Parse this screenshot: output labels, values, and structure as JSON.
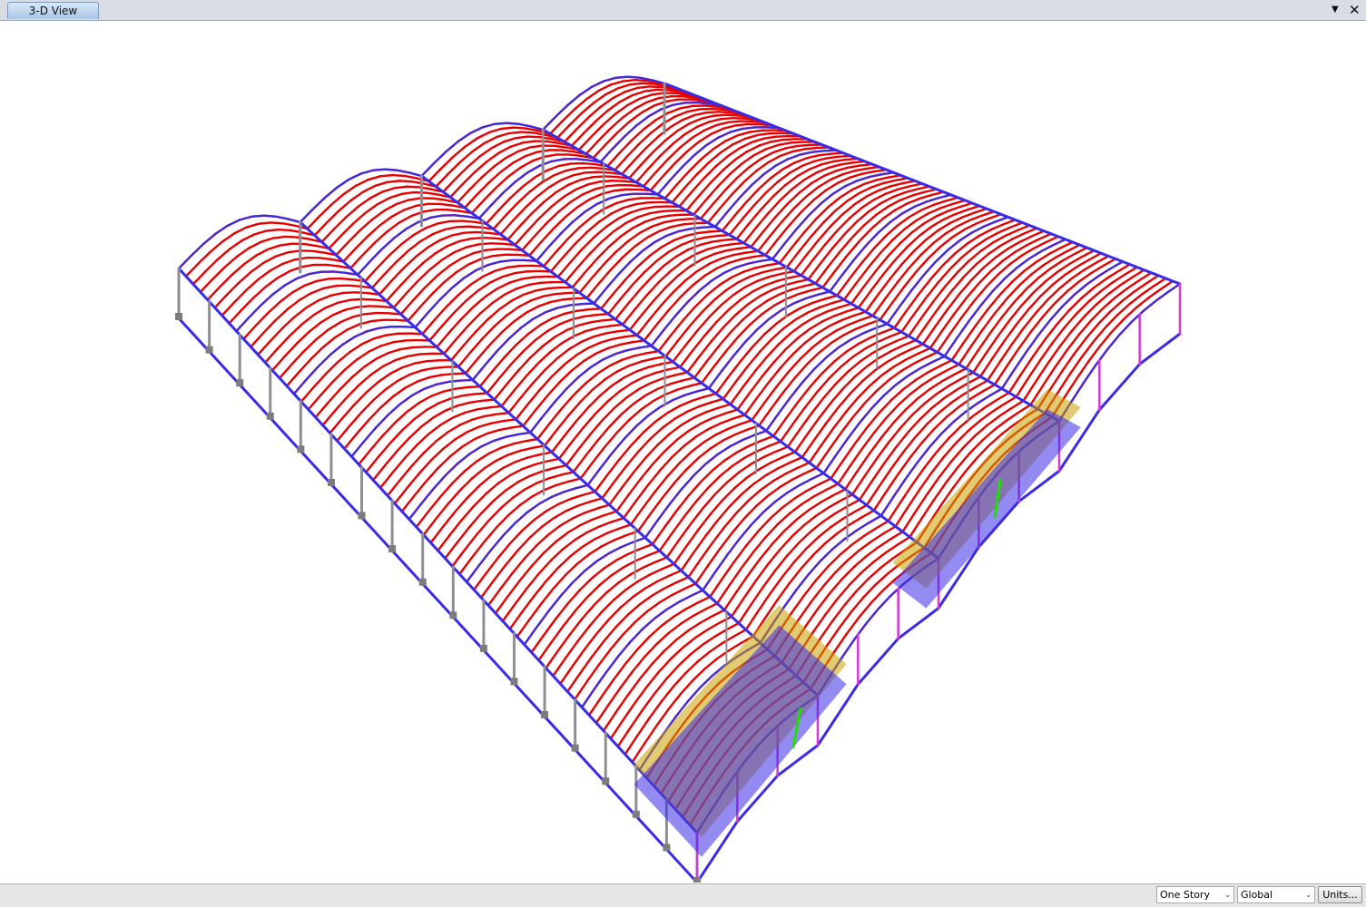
{
  "window": {
    "tab_title": "3-D View"
  },
  "model": {
    "description_icon": "3d-steel-frame-model",
    "colors": {
      "beam": "#e80000",
      "girder": "#3a2be8",
      "column": "#8e8e96",
      "brace": "#d400d4",
      "slab": "#c8a000",
      "support": "#1ee000"
    }
  },
  "statusbar": {
    "story_option": "One Story",
    "coord_option": "Global",
    "units_label": "Units..."
  }
}
